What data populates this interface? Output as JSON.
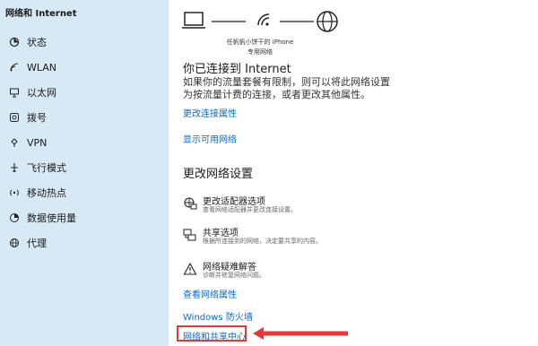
{
  "window": {
    "title": "网络和 Internet"
  },
  "sidebar": {
    "items": [
      {
        "label": "状态",
        "icon": "home-icon"
      },
      {
        "label": "WLAN",
        "icon": "wifi-icon"
      },
      {
        "label": "以太网",
        "icon": "ethernet-icon"
      },
      {
        "label": "拨号",
        "icon": "dialup-icon"
      },
      {
        "label": "VPN",
        "icon": "vpn-icon"
      },
      {
        "label": "飞行模式",
        "icon": "airplane-icon"
      },
      {
        "label": "移动热点",
        "icon": "hotspot-icon"
      },
      {
        "label": "数据使用量",
        "icon": "data-usage-icon"
      },
      {
        "label": "代理",
        "icon": "globe-icon"
      }
    ]
  },
  "status": {
    "device_name": "任帆帆小饼干的 iPhone",
    "network_type": "专用网络",
    "heading": "你已连接到 Internet",
    "description": "如果你的流量套餐有限制，则可以将此网络设置为按流量计费的连接，或者更改其他属性。",
    "links": {
      "change_properties": "更改连接属性",
      "show_networks": "显示可用网络"
    }
  },
  "change_settings": {
    "heading": "更改网络设置",
    "options": [
      {
        "title": "更改适配器选项",
        "desc": "查看网络适配器并更改连接设置。",
        "icon": "adapter-icon"
      },
      {
        "title": "共享选项",
        "desc": "根据所连接到的网络，决定要共享的内容。",
        "icon": "sharing-icon"
      },
      {
        "title": "网络疑难解答",
        "desc": "诊断并修复网络问题。",
        "icon": "warning-icon"
      }
    ]
  },
  "bottom_links": {
    "view_properties": "查看网络属性",
    "firewall": "Windows 防火墙",
    "sharing_center": "网络和共享中心"
  },
  "colors": {
    "sidebar_bg": "#d8e9f6",
    "link": "#0b6ac4",
    "highlight": "#e23a3a"
  }
}
